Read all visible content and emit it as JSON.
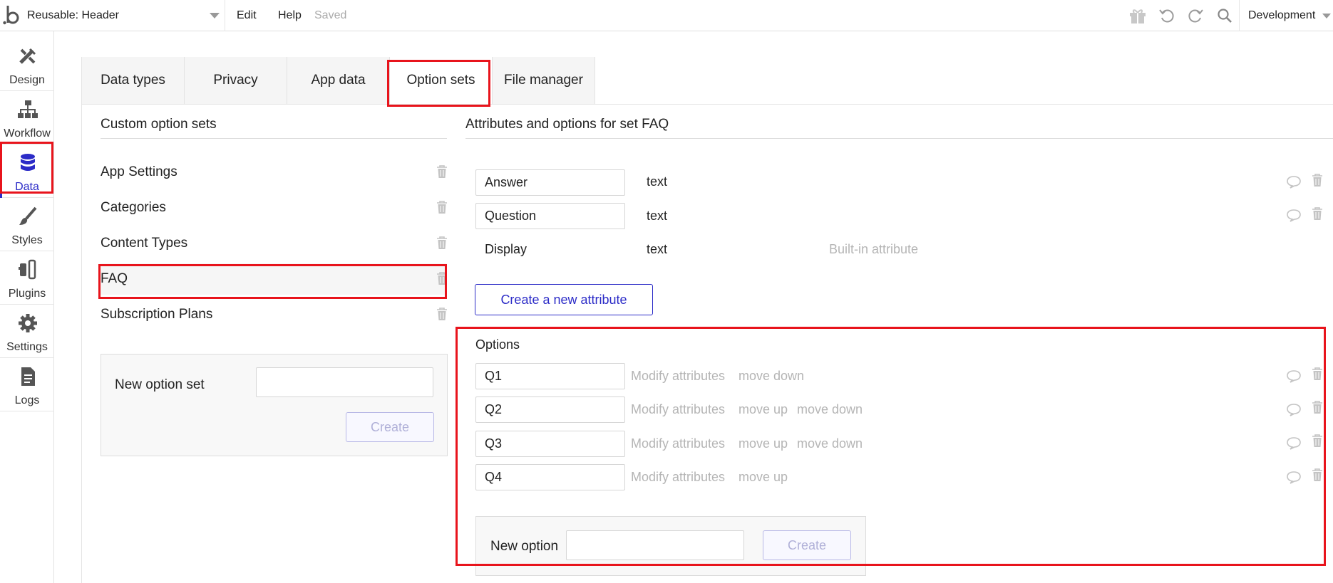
{
  "topbar": {
    "page_name": "Reusable: Header",
    "menu_edit": "Edit",
    "menu_help": "Help",
    "status": "Saved",
    "environment": "Development",
    "icons": [
      "gift-icon",
      "undo-icon",
      "redo-icon",
      "search-icon"
    ]
  },
  "sidebar": {
    "items": [
      {
        "label": "Design",
        "icon": "design-icon"
      },
      {
        "label": "Workflow",
        "icon": "workflow-icon"
      },
      {
        "label": "Data",
        "icon": "database-icon",
        "active": true
      },
      {
        "label": "Styles",
        "icon": "brush-icon"
      },
      {
        "label": "Plugins",
        "icon": "plug-icon"
      },
      {
        "label": "Settings",
        "icon": "gear-icon"
      },
      {
        "label": "Logs",
        "icon": "document-icon"
      }
    ]
  },
  "tabs": [
    {
      "label": "Data types"
    },
    {
      "label": "Privacy"
    },
    {
      "label": "App data"
    },
    {
      "label": "Option sets",
      "active": true
    },
    {
      "label": "File manager"
    }
  ],
  "option_sets": {
    "title": "Custom option sets",
    "items": [
      {
        "name": "App Settings"
      },
      {
        "name": "Categories"
      },
      {
        "name": "Content Types"
      },
      {
        "name": "FAQ",
        "selected": true
      },
      {
        "name": "Subscription Plans"
      }
    ],
    "new_label": "New option set",
    "new_value": "",
    "create_label": "Create"
  },
  "attributes": {
    "title": "Attributes and options for set FAQ",
    "items": [
      {
        "name": "Answer",
        "type": "text"
      },
      {
        "name": "Question",
        "type": "text"
      }
    ],
    "display": {
      "name": "Display",
      "type": "text",
      "note": "Built-in attribute"
    },
    "create_label": "Create a new attribute"
  },
  "options": {
    "title": "Options",
    "items": [
      {
        "name": "Q1",
        "modify": "Modify attributes",
        "up": "",
        "down": "move down"
      },
      {
        "name": "Q2",
        "modify": "Modify attributes",
        "up": "move up",
        "down": "move down"
      },
      {
        "name": "Q3",
        "modify": "Modify attributes",
        "up": "move up",
        "down": "move down"
      },
      {
        "name": "Q4",
        "modify": "Modify attributes",
        "up": "move up",
        "down": ""
      }
    ],
    "new_label": "New option",
    "new_value": "",
    "create_label": "Create"
  },
  "colors": {
    "accent": "#2b2bc7",
    "highlight": "#e8141c",
    "muted_text": "#b5b5b5"
  }
}
